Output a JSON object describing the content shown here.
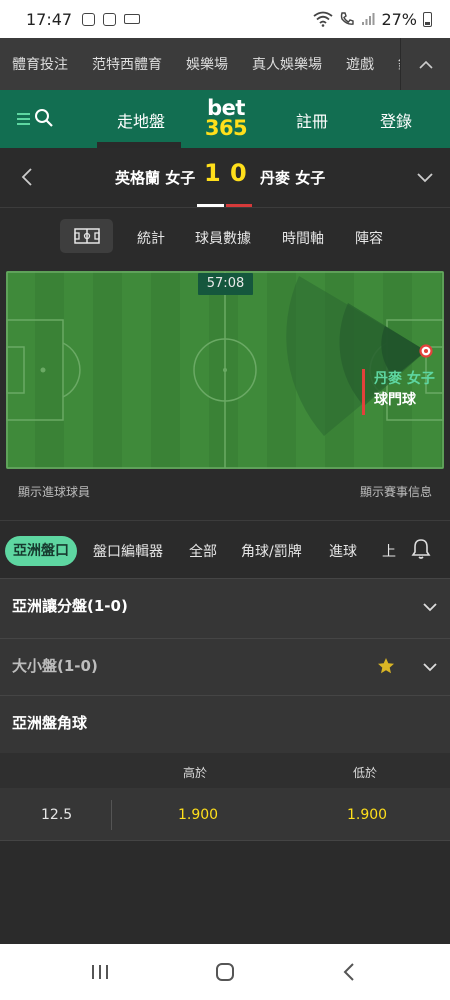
{
  "status_bar": {
    "time": "17:47",
    "battery": "27%"
  },
  "top_nav": {
    "items": [
      "體育投注",
      "范特西體育",
      "娛樂場",
      "真人娛樂場",
      "遊戲",
      "釨"
    ]
  },
  "header": {
    "inplay": "走地盤",
    "logo_top": "bet",
    "logo_bottom": "365",
    "register": "註冊",
    "login": "登錄"
  },
  "match": {
    "home_team": "英格蘭 女子",
    "home_score": "1",
    "away_score": "0",
    "away_team": "丹麥 女子"
  },
  "sub_tabs": [
    "統計",
    "球員數據",
    "時間軸",
    "陣容"
  ],
  "pitch": {
    "clock": "57:08",
    "event_team": "丹麥 女子",
    "event_type": "球門球"
  },
  "pitch_footer": {
    "left": "顯示進球球員",
    "right": "顯示賽事信息"
  },
  "market_tabs": [
    "亞洲盤口",
    "盤口編輯器",
    "全部",
    "角球/罰牌",
    "進球",
    "上"
  ],
  "markets": [
    {
      "title": "亞洲讓分盤(1-0)"
    },
    {
      "title": "大小盤(1-0)"
    },
    {
      "title": "亞洲盤角球"
    }
  ],
  "odds_table": {
    "col_over": "高於",
    "col_under": "低於",
    "line": "12.5",
    "over": "1.900",
    "under": "1.900"
  },
  "colors": {
    "brand_green": "#126e51",
    "accent_green": "#5ed6a1",
    "odds_yellow": "#ffdf1b",
    "pitch_green": "#3f8a3a"
  }
}
